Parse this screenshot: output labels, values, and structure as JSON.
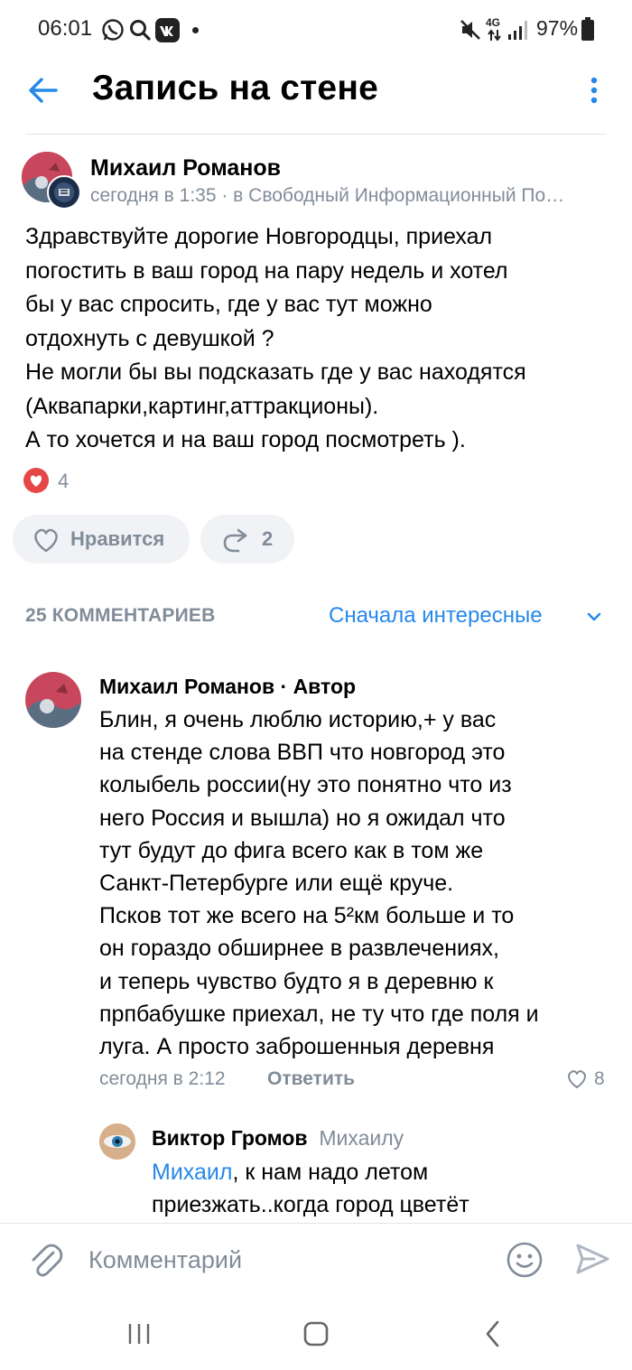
{
  "status_bar": {
    "time": "06:01",
    "battery": "97%",
    "network": "4G"
  },
  "header": {
    "title": "Запись на стене"
  },
  "post": {
    "author": "Михаил Романов",
    "meta": "сегодня в 1:35 · в Свободный Информационный По…",
    "text": "Здравствуйте дорогие Новгородцы, приехал\nпогостить в ваш город на пару недель и хотел\nбы у вас спросить, где у вас тут можно\nотдохнуть с девушкой ?\nНе могли бы вы подсказать где у вас находятся\n(Аквапарки,картинг,аттракционы).\nА то хочется и на ваш город посмотреть ).",
    "reactions_count": "4",
    "like_label": "Нравится",
    "share_count": "2"
  },
  "comments": {
    "count_label": "25 КОММЕНТАРИЕВ",
    "sort_label": "Сначала интересные",
    "items": [
      {
        "author": "Михаил Романов",
        "badge": " · Автор",
        "text": "Блин, я очень люблю историю,+ у вас\nна стенде слова ВВП что новгород это\nколыбель россии(ну это понятно что из\nнего Россия и вышла) но я ожидал что\nтут будут до фига всего как в том же\nСанкт-Петербурге или ещё круче.\nПсков тот же всего на 5²км больше и то\nон гораздо обширнее в развлечениях,\nи теперь чувство будто я в деревню к\nпрпбабушке приехал, не ту что где поля и\nлуга. А просто заброшенныя деревня",
        "time": "сегодня в 2:12",
        "reply_label": "Ответить",
        "likes": "8"
      },
      {
        "author": "Виктор Громов",
        "reply_to": "Михаилу",
        "mention": "Михаил",
        "text_line1": ", к нам надо летом",
        "text_line2": "приезжать..когда город цветёт"
      }
    ]
  },
  "composer": {
    "placeholder": "Комментарий"
  },
  "colors": {
    "accent": "#2688eb",
    "secondary_text": "#818c99",
    "heart": "#e64646",
    "pill_bg": "#f0f2f5"
  }
}
